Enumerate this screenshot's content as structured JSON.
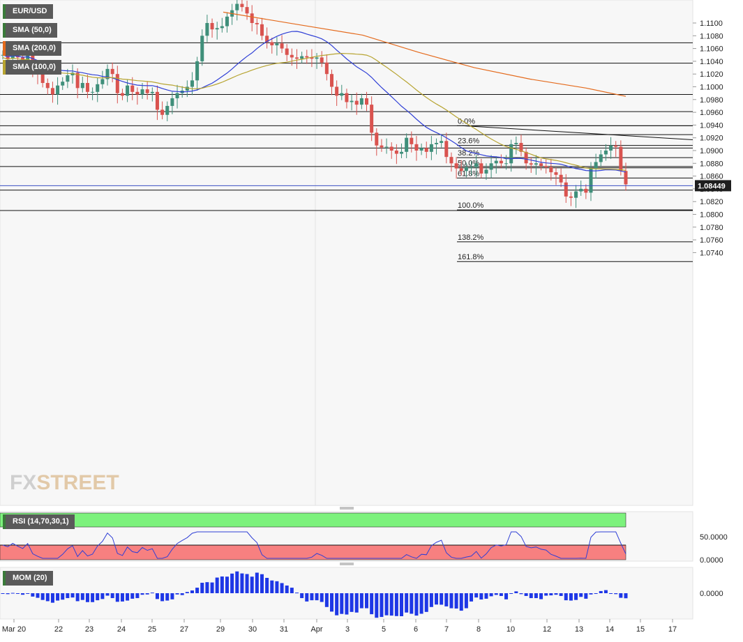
{
  "chart_data": {
    "type": "candlestick",
    "symbol": "EUR/USD",
    "indicators": [
      "SMA (50,0)",
      "SMA (200,0)",
      "SMA (100,0)"
    ],
    "indicator_colors": {
      "sma50": "#2f3fd6",
      "sma200": "#e46a1c",
      "sma100": "#b7a431"
    },
    "price_axis": {
      "ticks": [
        "1.1100",
        "1.1080",
        "1.1060",
        "1.1040",
        "1.1020",
        "1.1000",
        "1.0980",
        "1.0960",
        "1.0940",
        "1.0920",
        "1.0900",
        "1.0880",
        "1.0860",
        "1.0840",
        "1.0820",
        "1.0800",
        "1.0780",
        "1.0760",
        "1.0740"
      ],
      "ylim": [
        1.0727,
        1.1117
      ]
    },
    "current_price": "1.08449",
    "date_labels": [
      "Mar 20",
      "22",
      "23",
      "24",
      "25",
      "27",
      "29",
      "30",
      "31",
      "Apr",
      "3",
      "5",
      "6",
      "7",
      "8",
      "10",
      "12",
      "13",
      "14",
      "15",
      "17"
    ],
    "horizontal_levels": [
      1.1069,
      1.1037,
      1.0988,
      1.0961,
      1.0939,
      1.0925,
      1.0904,
      1.0875,
      1.0838,
      1.0806
    ],
    "fibonacci": [
      {
        "label": "0.0%",
        "price": 1.0939
      },
      {
        "label": "23.6%",
        "price": 1.0908
      },
      {
        "label": "38.2%",
        "price": 1.0889
      },
      {
        "label": "50.0%",
        "price": 1.0873
      },
      {
        "label": "61.8%",
        "price": 1.0857
      },
      {
        "label": "100.0%",
        "price": 1.0807
      },
      {
        "label": "138.2%",
        "price": 1.0757
      },
      {
        "label": "161.8%",
        "price": 1.0726
      }
    ],
    "trendline": {
      "from_date": "Apr 7",
      "from": 1.0939,
      "to": 1.0917
    },
    "rsi": {
      "label": "RSI (14,70,30,1)",
      "axis": [
        "50.0000",
        "0.0000"
      ]
    },
    "momentum": {
      "label": "MOM (20)",
      "axis": [
        "0.0000"
      ]
    },
    "grid": false
  },
  "watermark": "FXSTREET"
}
